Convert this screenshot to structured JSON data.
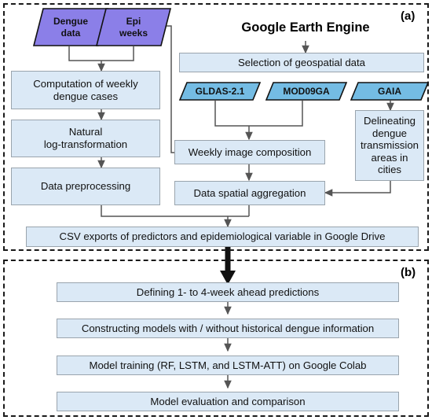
{
  "panels": {
    "a": {
      "tag": "(a)"
    },
    "b": {
      "tag": "(b)"
    }
  },
  "gee": {
    "title": "Google Earth Engine"
  },
  "inputs": [
    {
      "id": "dengue-data",
      "label": "Dengue\ndata",
      "color": "#8b7fe8",
      "shape": "parallelogram"
    },
    {
      "id": "epi-weeks",
      "label": "Epi\nweeks",
      "color": "#8b7fe8",
      "shape": "parallelogram"
    }
  ],
  "datasets": [
    {
      "id": "gldas",
      "label": "GLDAS-2.1",
      "color": "#74bce4",
      "shape": "parallelogram"
    },
    {
      "id": "mod09ga",
      "label": "MOD09GA",
      "color": "#74bce4",
      "shape": "parallelogram"
    },
    {
      "id": "gaia",
      "label": "GAIA",
      "color": "#74bce4",
      "shape": "parallelogram"
    }
  ],
  "panel_a_steps": {
    "selection": "Selection of geospatial data",
    "computation": "Computation of weekly\ndengue cases",
    "log": "Natural\nlog-transformation",
    "preprocessing": "Data preprocessing",
    "weekly_composition": "Weekly image composition",
    "spatial_aggregation": "Data spatial aggregation",
    "delineating": "Delineating\ndengue\ntransmission\nareas in cities",
    "csv": "CSV exports of predictors and epidemiological variable in Google Drive"
  },
  "panel_b_steps": [
    "Defining 1- to 4-week ahead predictions",
    "Constructing models with / without historical dengue information",
    "Model training (RF, LSTM, and LSTM-ATT) on Google Colab",
    "Model evaluation and comparison"
  ],
  "colors": {
    "box_fill": "#dbe9f6",
    "box_stroke": "#9aa4ad",
    "parallelogram_purple": "#8b7fe8",
    "parallelogram_blue": "#74bce4",
    "arrow": "#555555",
    "panel_border": "#1a1a1a"
  }
}
